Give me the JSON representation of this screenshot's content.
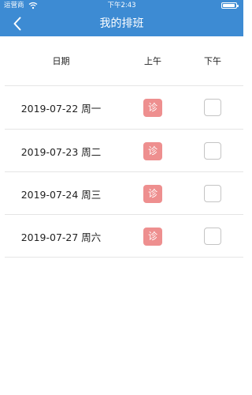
{
  "status_bar": {
    "carrier": "运营商",
    "time": "下午2:43"
  },
  "nav": {
    "title": "我的排班",
    "back_icon": "chevron-left-icon"
  },
  "table": {
    "headers": {
      "date": "日期",
      "am": "上午",
      "pm": "下午"
    },
    "rows": [
      {
        "date": "2019-07-22 周一",
        "am": "诊",
        "pm_checked": false
      },
      {
        "date": "2019-07-23 周二",
        "am": "诊",
        "pm_checked": false
      },
      {
        "date": "2019-07-24 周三",
        "am": "诊",
        "pm_checked": false
      },
      {
        "date": "2019-07-27 周六",
        "am": "诊",
        "pm_checked": false
      }
    ]
  },
  "colors": {
    "header_bg": "#3d8bd3",
    "badge_bg": "#ee8f8f",
    "divider": "#e5e5e5"
  }
}
